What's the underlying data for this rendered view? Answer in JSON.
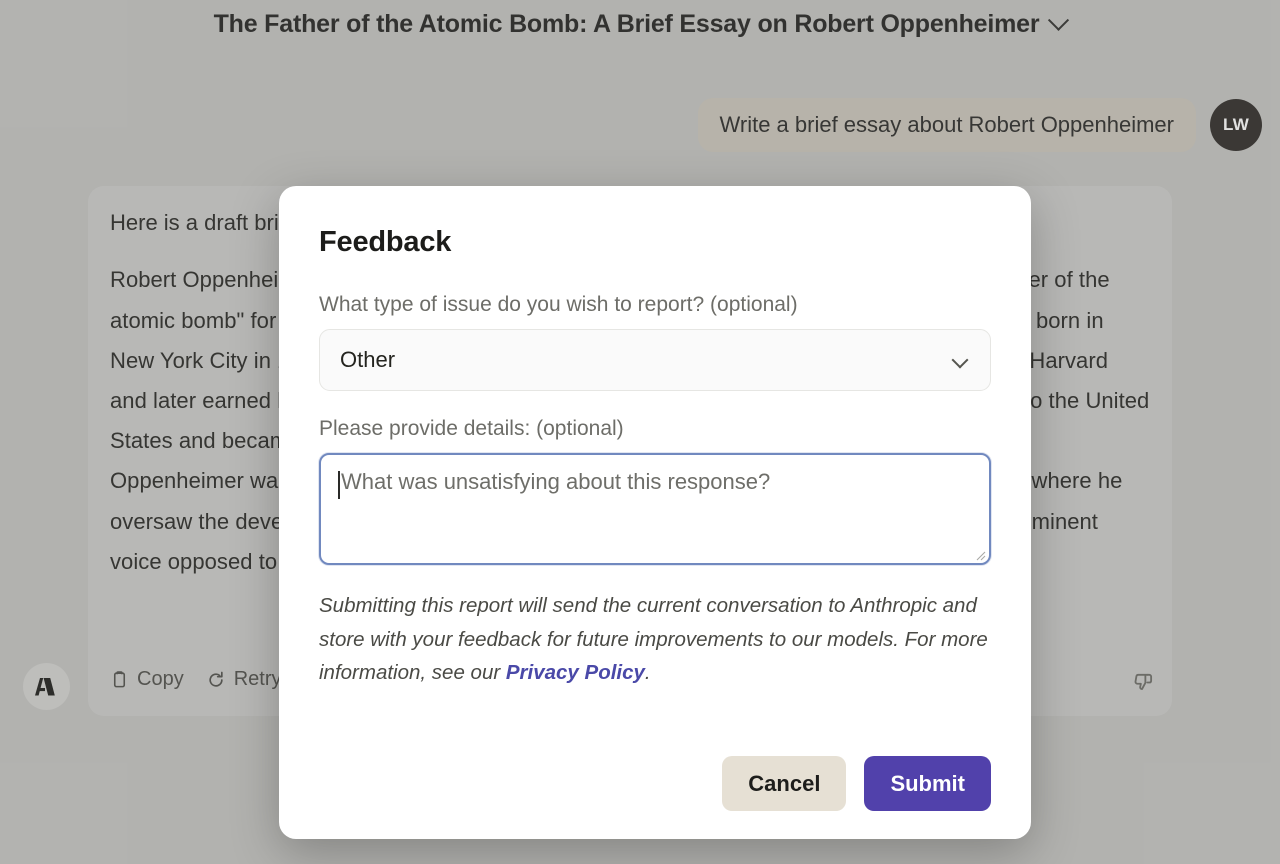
{
  "conversation": {
    "title": "The Father of the Atomic Bomb: A Brief Essay on Robert Oppenheimer",
    "title_chevron_icon": "chevron-down-icon"
  },
  "user_message": {
    "text": "Write a brief essay about Robert Oppenheimer",
    "avatar_initials": "LW"
  },
  "assistant_message": {
    "intro": "Here is a draft brief essay about Robert Oppenheimer:",
    "body": "Robert Oppenheimer was an American theoretical physicist who is widely considered the \"father of the atomic bomb\" for his role as the scientific director of the Manhattan Project. Oppenheimer was born in New York City in 1904 and showed great potential in science from an early age. He studied at Harvard and later earned his PhD in physics at Göttingen in Germany. In 1929 Oppenheimer returned to the United States and became a professor at the University of California, Berkeley. During World War II, Oppenheimer was chosen to lead the secret weapons laboratory at Los Alamos, New Mexico, where he oversaw the development of the first atomic bombs. After the war, Oppenheimer became a prominent voice opposed to the development of the hydrogen bomb."
  },
  "action_bar": {
    "copy_label": "Copy",
    "copy_icon": "clipboard-icon",
    "retry_label": "Retry",
    "retry_icon": "refresh-icon",
    "thumbs_down_icon": "thumbs-down-icon",
    "anthropic_logo_icon": "anthropic-logo-icon"
  },
  "modal": {
    "title": "Feedback",
    "issue_type": {
      "label": "What type of issue do you wish to report? (optional)",
      "selected": "Other",
      "chevron_icon": "chevron-down-icon"
    },
    "details": {
      "label": "Please provide details: (optional)",
      "value": "",
      "placeholder": "What was unsatisfying about this response?",
      "resize_icon": "resize-grip-icon"
    },
    "disclaimer": {
      "before_link": "Submitting this report will send the current conversation to Anthropic and store with your feedback for future improvements to our models. For more information, see our ",
      "link_text": "Privacy Policy",
      "after_link": "."
    },
    "footer": {
      "cancel_label": "Cancel",
      "submit_label": "Submit"
    }
  },
  "colors": {
    "page_background": "#c3c3c1",
    "assistant_card": "#cbcbc9",
    "user_bubble": "#c9c4ba",
    "submit_purple": "#5141ab",
    "cancel_beige": "#e6e0d4",
    "link_purple": "#4a49a8",
    "focus_blue": "#7189bf"
  }
}
